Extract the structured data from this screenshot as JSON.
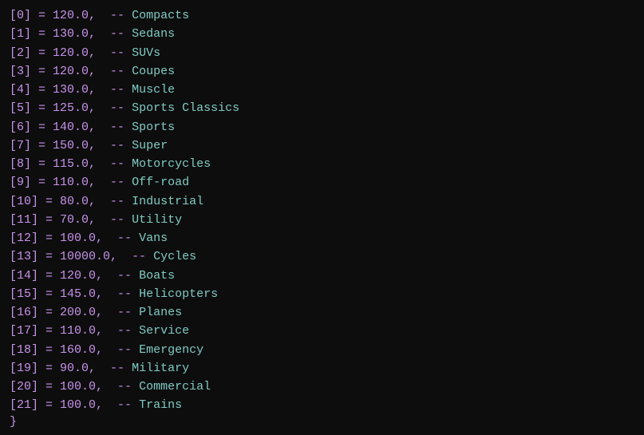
{
  "items": [
    {
      "index": 0,
      "value": "120.0",
      "label": "Compacts"
    },
    {
      "index": 1,
      "value": "130.0",
      "label": "Sedans"
    },
    {
      "index": 2,
      "value": "120.0",
      "label": "SUVs"
    },
    {
      "index": 3,
      "value": "120.0",
      "label": "Coupes"
    },
    {
      "index": 4,
      "value": "130.0",
      "label": "Muscle"
    },
    {
      "index": 5,
      "value": "125.0",
      "label": "Sports Classics"
    },
    {
      "index": 6,
      "value": "140.0",
      "label": "Sports"
    },
    {
      "index": 7,
      "value": "150.0",
      "label": "Super"
    },
    {
      "index": 8,
      "value": "115.0",
      "label": "Motorcycles"
    },
    {
      "index": 9,
      "value": "110.0",
      "label": "Off-road"
    },
    {
      "index": 10,
      "value": "80.0",
      "label": "Industrial"
    },
    {
      "index": 11,
      "value": "70.0",
      "label": "Utility"
    },
    {
      "index": 12,
      "value": "100.0",
      "label": "Vans"
    },
    {
      "index": 13,
      "value": "10000.0",
      "label": "Cycles"
    },
    {
      "index": 14,
      "value": "120.0",
      "label": "Boats"
    },
    {
      "index": 15,
      "value": "145.0",
      "label": "Helicopters"
    },
    {
      "index": 16,
      "value": "200.0",
      "label": "Planes"
    },
    {
      "index": 17,
      "value": "110.0",
      "label": "Service"
    },
    {
      "index": 18,
      "value": "160.0",
      "label": "Emergency"
    },
    {
      "index": 19,
      "value": "90.0",
      "label": "Military"
    },
    {
      "index": 20,
      "value": "100.0",
      "label": "Commercial"
    },
    {
      "index": 21,
      "value": "100.0",
      "label": "Trains"
    }
  ],
  "closing_brace": "}"
}
